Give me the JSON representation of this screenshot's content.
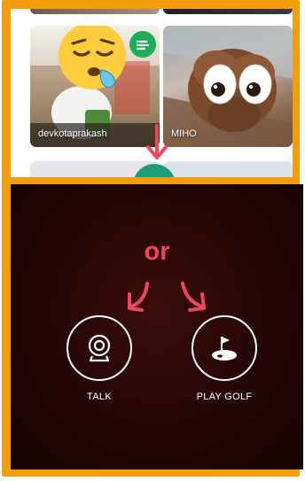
{
  "cards": [
    {
      "username": "devkotaprakash"
    },
    {
      "username": "MIHO"
    }
  ],
  "divider": {
    "text": "or"
  },
  "options": [
    {
      "label": "TALK"
    },
    {
      "label": "PLAY GOLF"
    }
  ],
  "colors": {
    "frame": "#f59e0b",
    "accent": "#f0445f",
    "dark_bg": "#230605",
    "green": "#1f9c7a"
  }
}
